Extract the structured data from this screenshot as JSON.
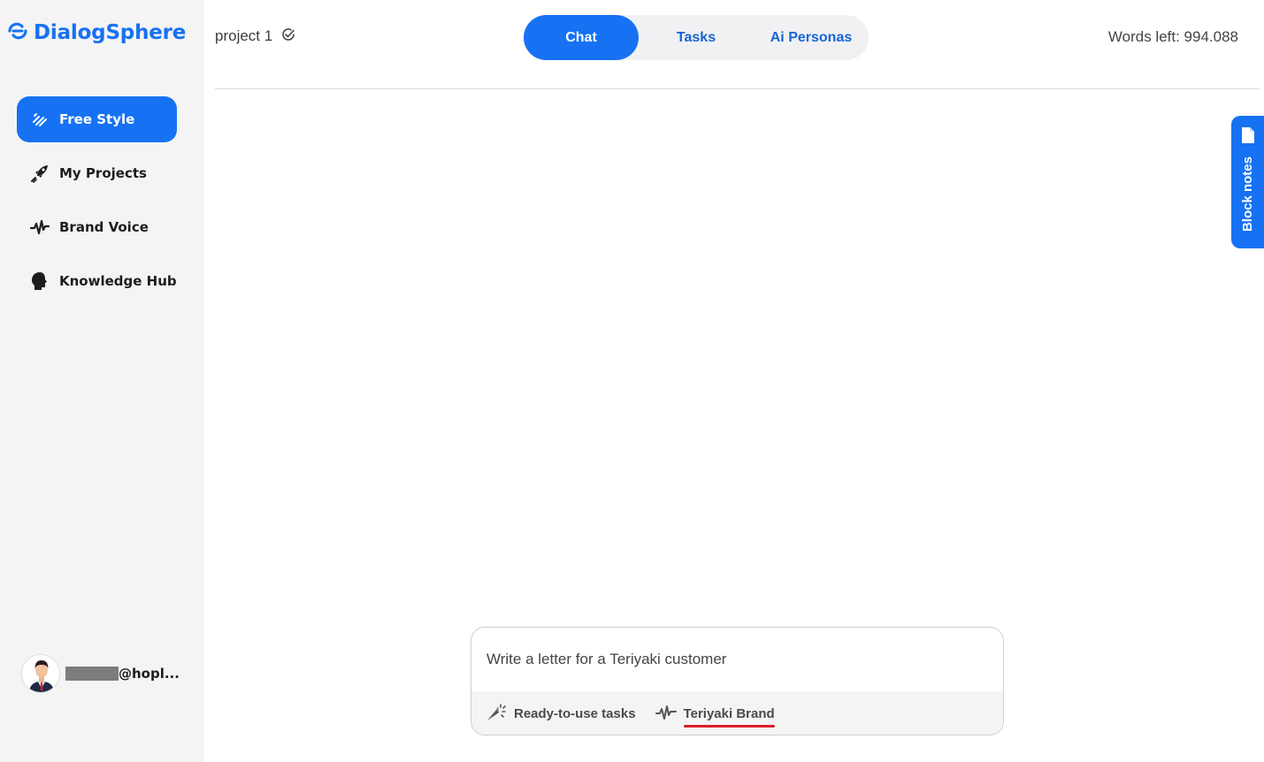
{
  "app": {
    "name": "DialogSphere",
    "brand_color": "#1672f3"
  },
  "sidebar": {
    "items": [
      {
        "label": "Free Style",
        "icon": "pen-lines-icon",
        "active": true
      },
      {
        "label": "My Projects",
        "icon": "rocket-icon",
        "active": false
      },
      {
        "label": "Brand Voice",
        "icon": "waveform-icon",
        "active": false
      },
      {
        "label": "Knowledge Hub",
        "icon": "head-icon",
        "active": false
      }
    ],
    "user": {
      "email_suffix": "@hopl..."
    }
  },
  "header": {
    "project_name": "project 1",
    "tabs": [
      {
        "label": "Chat",
        "active": true
      },
      {
        "label": "Tasks",
        "active": false
      },
      {
        "label": "Ai Personas",
        "active": false
      }
    ],
    "words_left": "Words left: 994.088"
  },
  "block_notes": {
    "label": "Block notes"
  },
  "composer": {
    "value": "Write a letter for a Teriyaki customer",
    "tasks_label": "Ready-to-use tasks",
    "brand_label": "Teriyaki Brand"
  }
}
